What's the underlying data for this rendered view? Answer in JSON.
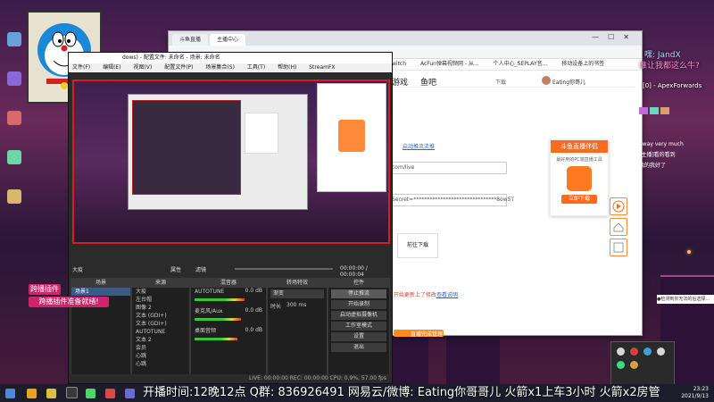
{
  "browser": {
    "tabs": [
      {
        "label": "斗鱼直播"
      },
      {
        "label": "主播中心"
      }
    ],
    "bookmarks": [
      "witch",
      "AcFun弹幕视频网 - 从...",
      "个人中心_SEPLAY音...",
      "移动设备上的书签"
    ],
    "nav": {
      "game": "游戏",
      "fishbar": "鱼吧",
      "download": "下载",
      "user": "Eating你哥儿"
    },
    "rtmp_link": "启动推流流推",
    "rtmp_url": "com/live",
    "stream_key": "Secret=*******************************8ow5T",
    "download_btn": "前往下载",
    "help_link1": "开始更新上了修改",
    "help_link2": "查看说明",
    "orange_btn1": "",
    "orange_btn2": "直播完成管理",
    "douyu_card": {
      "title": "斗鱼直播伴侣",
      "subtitle": "最好用的PC端直播工具",
      "button": "立即下载"
    }
  },
  "obs": {
    "title": "dows) - 配置文件: 未命名 - 场景: 未命名",
    "menu": [
      "文件(F)",
      "编辑(E)",
      "视图(V)",
      "配置文件(P)",
      "场景集合(S)",
      "工具(T)",
      "帮助(H)",
      "StreamFX"
    ],
    "toolbar": {
      "label": "大疫",
      "props": "属性",
      "filter": "滤镜",
      "time": "00:00:00 / 00:00:04"
    },
    "docks": {
      "scenes": {
        "title": "场景",
        "items": [
          "场景1"
        ]
      },
      "sources": {
        "title": "来源",
        "items": [
          "大疫",
          "左台帽",
          "图像 2",
          "文本 (GDI+)",
          "文本 (GDI+)",
          "AUTOTUNE",
          "文本 2",
          "会员",
          "心跳",
          "心跳"
        ]
      },
      "mixer": {
        "title": "混音器",
        "channels": [
          {
            "name": "AUTOTUNE",
            "db": "0.0 dB"
          },
          {
            "name": "麦克风/Aux",
            "db": "0.0 dB"
          },
          {
            "name": "桌面音频",
            "db": "0.0 dB"
          }
        ]
      },
      "transitions": {
        "title": "转场特效",
        "type": "渐变",
        "duration_label": "时长",
        "duration": "300 ms"
      },
      "controls": {
        "title": "控件",
        "buttons": [
          "停止推流",
          "开始录制",
          "启动虚拟摄像机",
          "工作室模式",
          "设置",
          "退出"
        ]
      }
    },
    "status": "LIVE: 00:00:00   REC: 00:00:00   CPU: 0.9%, 57.00 fps"
  },
  "overlays": {
    "plugin1": "跨播插件",
    "plugin2": "跨播插件准备就绪!",
    "top_right_1": "嘿: JandX",
    "top_right_2": "谁让我都这么牛?",
    "stream_info": "[0] - ApexForwards"
  },
  "chat": {
    "lines": [
      "Sway very much",
      "[主播]看的看到",
      "我的我好了"
    ],
    "notice": "●检测到你无法的后选择..."
  },
  "ticker": "开播时间:12晚12点   Q群: 836926491      网易云/微博: Eating你哥哥儿   火箭x1上车3小时   火箭x2房管",
  "clock": {
    "time": "23:23",
    "date": "2021/9/13"
  }
}
